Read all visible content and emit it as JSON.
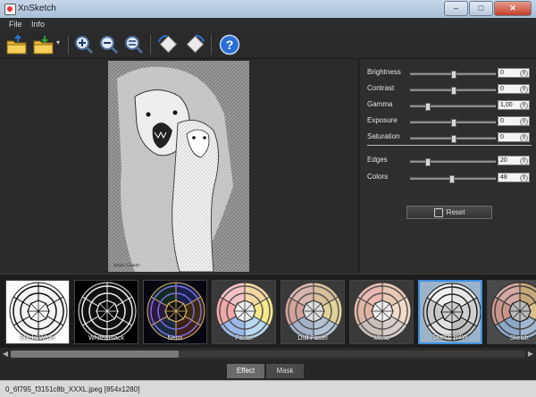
{
  "window": {
    "title": "XnSketch",
    "minimize": "–",
    "maximize": "□",
    "close": "✕"
  },
  "menu": {
    "file": "File",
    "info": "Info"
  },
  "toolbar": {
    "icons": [
      "open-folder-icon",
      "save-folder-icon",
      "zoom-in-icon",
      "zoom-out-icon",
      "zoom-fit-icon",
      "rotate-left-icon",
      "rotate-right-icon",
      "help-icon"
    ],
    "dropdown": "▾",
    "help_glyph": "?"
  },
  "adjustments": {
    "brightness": {
      "label": "Brightness",
      "value": "0",
      "level": 0.5
    },
    "contrast": {
      "label": "Contrast",
      "value": "0",
      "level": 0.5
    },
    "gamma": {
      "label": "Gamma",
      "value": "1,00",
      "level": 0.2
    },
    "exposure": {
      "label": "Exposure",
      "value": "0",
      "level": 0.5
    },
    "saturation": {
      "label": "Saturation",
      "value": "0",
      "level": 0.5
    },
    "edges": {
      "label": "Edges",
      "value": "20",
      "level": 0.2
    },
    "colors": {
      "label": "Colors",
      "value": "48",
      "level": 0.48
    }
  },
  "reset_label": "Reset",
  "spin_glyph": "⇕",
  "presets": [
    {
      "label": "Black&White",
      "style": "bw",
      "selected": false
    },
    {
      "label": "White&Black",
      "style": "wb",
      "selected": false
    },
    {
      "label": "Neon",
      "style": "neon",
      "selected": false
    },
    {
      "label": "Pastel",
      "style": "pastel",
      "selected": false
    },
    {
      "label": "Dull Pastel",
      "style": "dull",
      "selected": false
    },
    {
      "label": "Mono",
      "style": "mono",
      "selected": false
    },
    {
      "label": "Sketch B&W",
      "style": "sketch",
      "selected": true
    },
    {
      "label": "Sketch",
      "style": "sketchc",
      "selected": false
    }
  ],
  "scroll": {
    "left": "◀",
    "right": "▶"
  },
  "tabs": {
    "effect": "Effect",
    "mask": "Mask"
  },
  "status": "0_6f795_f3151c8b_XXXL.jpeg [854x1280]",
  "image": {
    "signature": "Sergey Gundyr"
  },
  "colors": {
    "accent": "#3d8edc",
    "help": "#2a6fd6"
  }
}
